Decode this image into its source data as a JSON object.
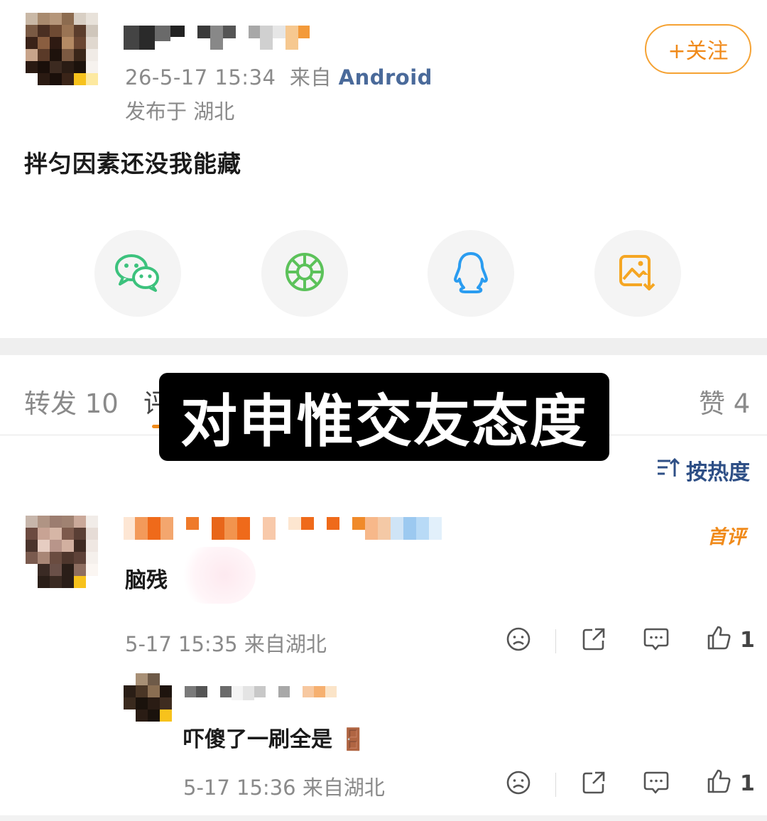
{
  "post": {
    "meta_time": "26-5-17 15:34",
    "meta_from": "来自",
    "meta_source": "Android",
    "location": "发布于 湖北",
    "text": "拌匀因素还没我能藏",
    "follow_label": "+关注"
  },
  "share": {
    "items": [
      {
        "icon": "wechat-icon"
      },
      {
        "icon": "moments-icon"
      },
      {
        "icon": "qq-icon"
      },
      {
        "icon": "save-image-icon"
      }
    ]
  },
  "tabs": {
    "repost": "转发 10",
    "comment_partial": "评",
    "likes": "赞 4"
  },
  "overlay": {
    "text": "对申惟交友态度"
  },
  "sort": {
    "label": "按热度",
    "icon": "sort-icon"
  },
  "comments": [
    {
      "text": "脑残",
      "badge": "首评",
      "meta": "5-17 15:35 来自湖北",
      "like_count": "1"
    }
  ],
  "replies": [
    {
      "text": "吓傻了一刷全是",
      "emoji": "🚪",
      "meta": "5-17 15:36 来自湖北",
      "like_count": "1"
    }
  ],
  "colors": {
    "accent_orange": "#f08a1a",
    "link_blue": "#4a6a9a",
    "wechat_green": "#3cc27d",
    "qq_blue": "#2a9cf0",
    "save_orange": "#f5a623"
  }
}
